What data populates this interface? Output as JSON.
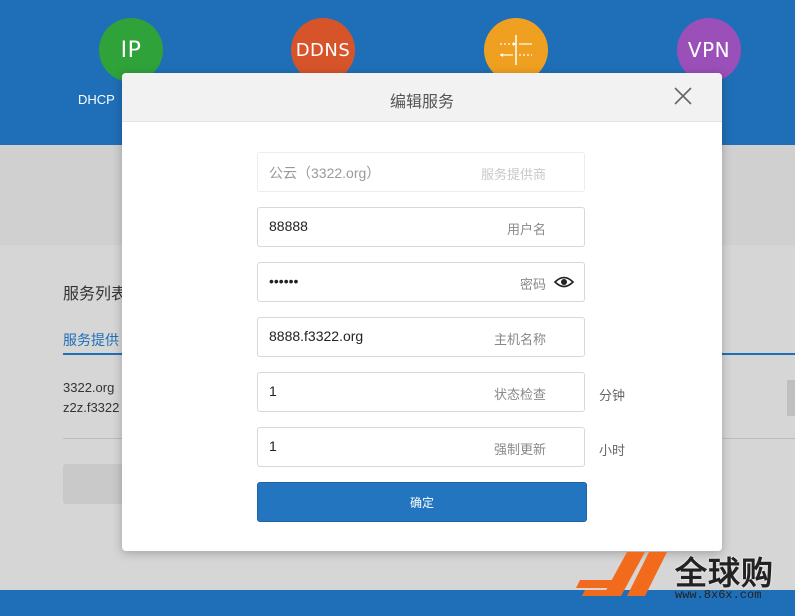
{
  "background": {
    "circles": [
      {
        "label": "IP",
        "icon": "ip-icon"
      },
      {
        "label": "DDNS",
        "icon": "ddns-icon"
      },
      {
        "label": "",
        "icon": "port-forward-icon"
      },
      {
        "label": "VPN",
        "icon": "vpn-icon"
      }
    ],
    "circle_caption": "DHCP",
    "section_title": "服务列表",
    "tab_label": "服务提供",
    "rows": [
      "3322.org",
      "z2z.f3322"
    ]
  },
  "modal": {
    "title": "编辑服务",
    "close_icon": "close-icon",
    "fields": [
      {
        "value": "公云（3322.org）",
        "label": "服务提供商"
      },
      {
        "value": "88888",
        "label": "用户名"
      },
      {
        "value": "••••••",
        "label": "密码"
      },
      {
        "value": "8888.f3322.org",
        "label": "主机名称"
      },
      {
        "value": "1",
        "label": "状态检查",
        "unit": "分钟"
      },
      {
        "value": "1",
        "label": "强制更新",
        "unit": "小时"
      }
    ],
    "confirm_label": "确定"
  },
  "watermark": {
    "text": "全球购",
    "url": "www.8x6x.com"
  },
  "colors": {
    "header_blue": "#1f6fb8",
    "ip_green": "#2fa23a",
    "ddns_orange": "#d7542a",
    "forward_yellow": "#f0a020",
    "vpn_purple": "#9b4fb8",
    "confirm_blue": "#2475c0"
  }
}
